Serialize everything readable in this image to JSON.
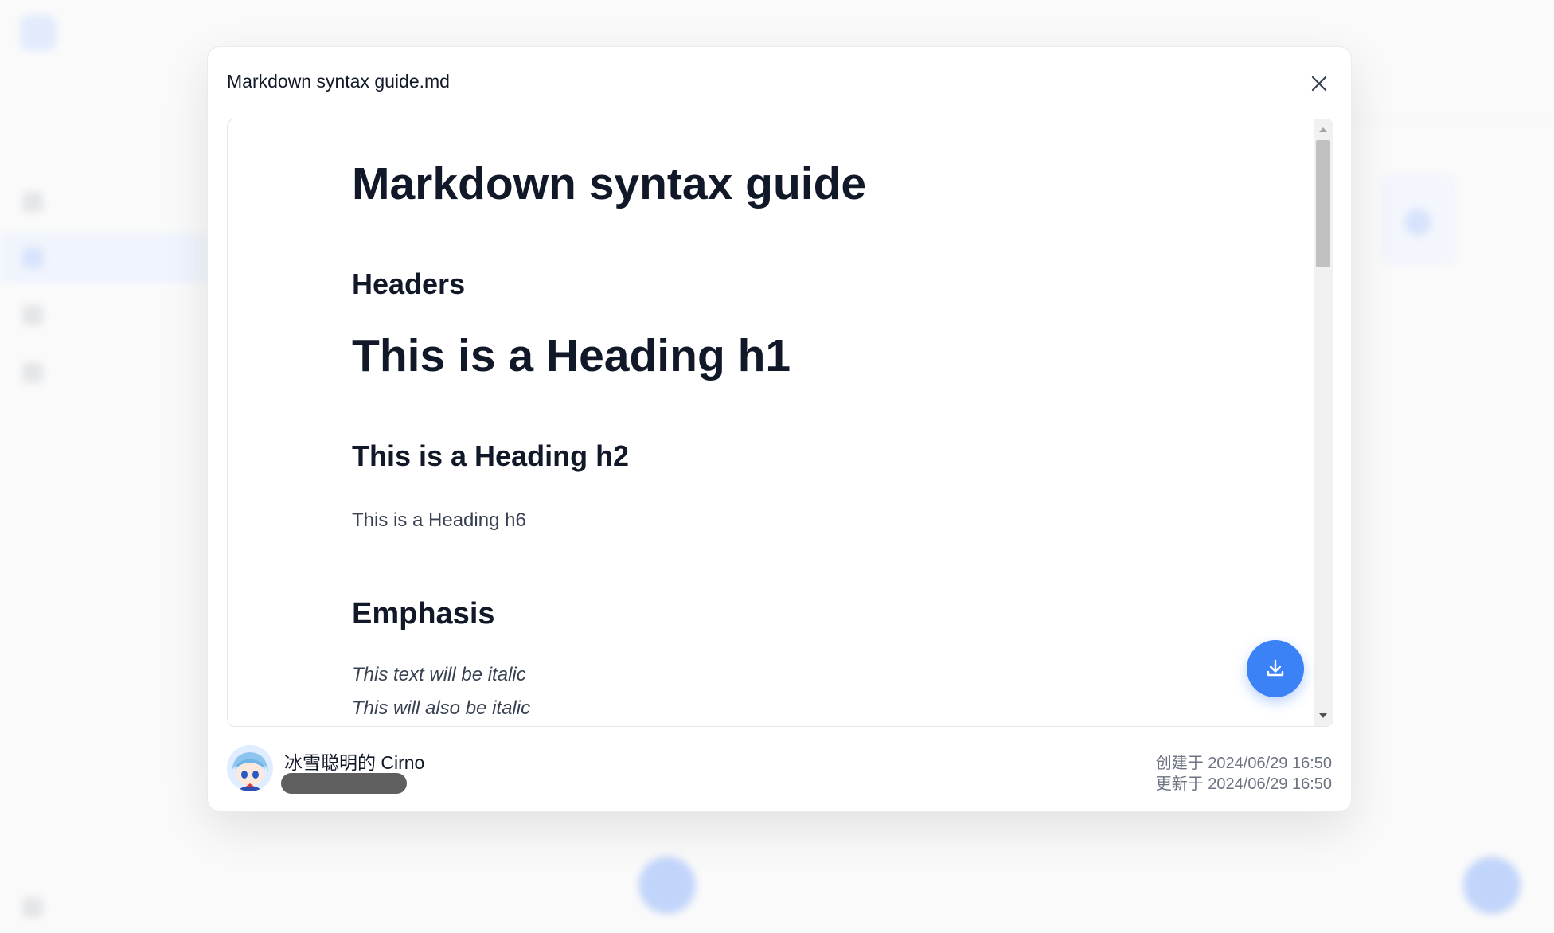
{
  "modal": {
    "title": "Markdown syntax guide.md",
    "close_icon": "close-icon",
    "download_icon": "download-icon"
  },
  "document": {
    "title": "Markdown syntax guide",
    "section_headers": "Headers",
    "heading_h1": "This is a Heading h1",
    "heading_h2": "This is a Heading h2",
    "heading_h6": "This is a Heading h6",
    "section_emphasis": "Emphasis",
    "italic_1": "This text will be italic",
    "italic_2": "This will also be italic"
  },
  "footer": {
    "author_name": "冰雪聪明的 Cirno",
    "created": "创建于 2024/06/29 16:50",
    "updated": "更新于 2024/06/29 16:50"
  },
  "colors": {
    "accent": "#3b82f6"
  }
}
